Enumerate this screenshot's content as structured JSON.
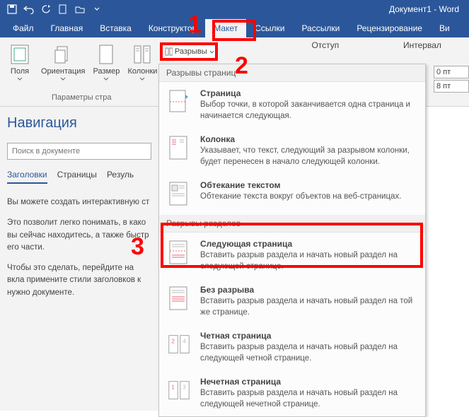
{
  "title": "Документ1 - Word",
  "qat": [
    "save",
    "undo",
    "redo",
    "new",
    "open",
    "touch"
  ],
  "tabs": [
    "Файл",
    "Главная",
    "Вставка",
    "Конструктор",
    "Макет",
    "Ссылки",
    "Рассылки",
    "Рецензирование",
    "Ви"
  ],
  "active_tab": 4,
  "ribbon": {
    "group1": {
      "buttons": [
        "Поля",
        "Ориентация",
        "Размер",
        "Колонки"
      ],
      "label": "Параметры стра"
    },
    "otst_label": "Отступ",
    "interval_label": "Интервал",
    "interval_values": [
      "0 пт",
      "8 пт"
    ]
  },
  "breaks_btn": "Разрывы",
  "nav": {
    "title": "Навигация",
    "search_placeholder": "Поиск в документе",
    "tabs": [
      "Заголовки",
      "Страницы",
      "Резуль"
    ],
    "p1": "Вы можете создать интерактивную ст",
    "p2": "Это позволит легко понимать, в како вы сейчас находитесь, а также быстр его части.",
    "p3": "Чтобы это сделать, перейдите на вкла примените стили заголовков к нужно документе."
  },
  "dd": {
    "sec1": "Разрывы страниц",
    "sec2": "Разрывы разделов",
    "items": [
      {
        "name": "Страница",
        "desc": "Выбор точки, в которой заканчивается одна страница и начинается следующая."
      },
      {
        "name": "Колонка",
        "desc": "Указывает, что текст, следующий за разрывом колонки, будет перенесен в начало следующей колонки."
      },
      {
        "name": "Обтекание текстом",
        "desc": "Обтекание текста вокруг объектов на веб-страницах."
      },
      {
        "name": "Следующая страница",
        "desc": "Вставить разрыв раздела и начать новый раздел на следующей странице."
      },
      {
        "name": "Без разрыва",
        "desc": "Вставить разрыв раздела и начать новый раздел на той же странице."
      },
      {
        "name": "Четная страница",
        "desc": "Вставить разрыв раздела и начать новый раздел на следующей четной странице."
      },
      {
        "name": "Нечетная страница",
        "desc": "Вставить разрыв раздела и начать новый раздел на следующей нечетной странице."
      }
    ]
  },
  "anno": {
    "n1": "1",
    "n2": "2",
    "n3": "3"
  }
}
